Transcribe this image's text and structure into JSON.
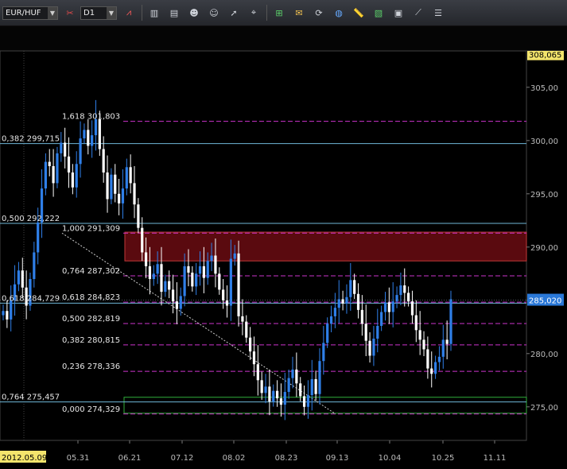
{
  "toolbar": {
    "symbol": "EUR/HUF",
    "timeframe": "D1",
    "icons": [
      "chart-type-icon",
      "cursor-icon",
      "bar-chart-icon",
      "candle-chart-icon",
      "people-icon",
      "people2-icon",
      "pointer-icon",
      "crosshair-icon",
      "add-indicator-icon",
      "comment-icon",
      "refresh-icon",
      "globe-icon",
      "ruler-icon",
      "image-icon",
      "window-icon",
      "draw-tools-icon",
      "layers-icon"
    ]
  },
  "colors": {
    "bull": "#2f7fe8",
    "bear": "#ffffff",
    "fib": "#cc33cc",
    "horizontal": "#6fb7d8",
    "resistance_zone": "#5a0a0f",
    "support_zone": "#2fae3a",
    "price_tag": "#f3e46c",
    "current_tag": "#2a78d8"
  },
  "chart_data": {
    "type": "candlestick",
    "symbol": "EUR/HUF",
    "timeframe": "D1",
    "ylim": [
      273.5,
      309
    ],
    "yticks": [
      "305,00",
      "300,00",
      "295,00",
      "290,00",
      "285,00",
      "280,00",
      "275,00"
    ],
    "ytick_values": [
      305,
      300,
      295,
      290,
      285,
      280,
      275
    ],
    "top_price_label": "308,065",
    "top_price_value": 308.065,
    "current_price_label": "285,020",
    "current_price_value": 285.02,
    "xticks": [
      "2012.05.09",
      "05.31",
      "06.21",
      "07.12",
      "08.02",
      "08.23",
      "09.13",
      "10.04",
      "10.25",
      "11.11"
    ],
    "horizontal_lines": [
      {
        "label": "0,382 299,715",
        "value": 299.715
      },
      {
        "label": "0,500 292,222",
        "value": 292.222
      },
      {
        "label": "0,618 284,729",
        "value": 284.729
      },
      {
        "label": "0,764 275,457",
        "value": 275.457
      }
    ],
    "fib_levels": [
      {
        "label": "1,618 301,803",
        "value": 301.803
      },
      {
        "label": "1,000 291,309",
        "value": 291.309
      },
      {
        "label": "0,764 287,302",
        "value": 287.302
      },
      {
        "label": "0,618 284,823",
        "value": 284.823
      },
      {
        "label": "0,500 282,819",
        "value": 282.819
      },
      {
        "label": "0,382 280,815",
        "value": 280.815
      },
      {
        "label": "0,236 278,336",
        "value": 278.336
      },
      {
        "label": "0,000 274,329",
        "value": 274.329
      }
    ],
    "resistance_zone": [
      288.7,
      291.4
    ],
    "support_zone": [
      274.4,
      275.9
    ],
    "closes": [
      284.0,
      283.2,
      285.0,
      286.5,
      287.8,
      286.2,
      284.5,
      287.0,
      289.5,
      292.3,
      295.5,
      298.0,
      297.6,
      296.0,
      298.8,
      299.8,
      298.5,
      297.0,
      295.6,
      297.8,
      300.2,
      301.0,
      299.5,
      300.5,
      302.0,
      299.2,
      297.0,
      294.5,
      296.8,
      295.0,
      294.1,
      295.5,
      297.5,
      296.0,
      294.0,
      291.8,
      289.5,
      288.2,
      287.0,
      287.5,
      288.4,
      285.8,
      286.8,
      286.0,
      284.9,
      284.2,
      285.4,
      288.2,
      287.6,
      286.3,
      287.5,
      288.2,
      287.1,
      288.7,
      289.2,
      287.5,
      286.0,
      285.0,
      284.5,
      288.9,
      289.4,
      283.5,
      283.0,
      281.5,
      280.2,
      279.0,
      277.5,
      276.3,
      276.9,
      275.5,
      276.5,
      275.8,
      275.2,
      276.4,
      277.7,
      278.5,
      277.2,
      276.0,
      275.0,
      276.1,
      277.6,
      276.2,
      279.3,
      281.0,
      282.8,
      283.5,
      284.3,
      285.1,
      284.7,
      285.3,
      286.9,
      285.6,
      284.1,
      282.8,
      281.2,
      279.8,
      281.4,
      282.6,
      283.9,
      284.8,
      283.9,
      284.9,
      285.5,
      286.4,
      285.7,
      284.9,
      283.6,
      282.2,
      281.3,
      280.4,
      278.6,
      278.1,
      279.2,
      279.7,
      281.3,
      280.9,
      285.1
    ]
  }
}
